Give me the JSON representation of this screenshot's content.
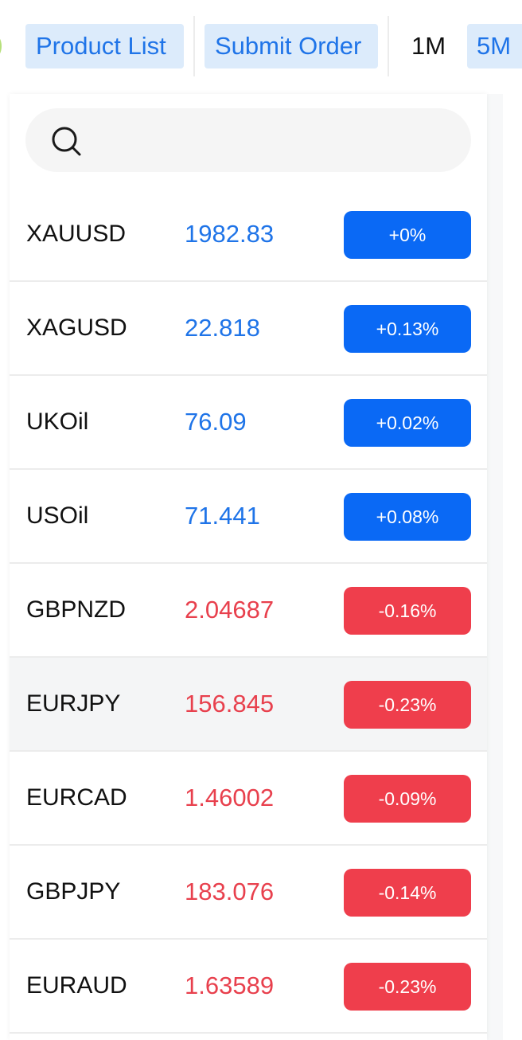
{
  "toolbar": {
    "product_list_label": "Product List",
    "submit_order_label": "Submit Order",
    "timeframes": [
      {
        "label": "1M",
        "active": false
      },
      {
        "label": "5M",
        "active": true
      }
    ]
  },
  "search": {
    "icon": "search-icon",
    "placeholder": "",
    "value": ""
  },
  "colors": {
    "accent": "#1f74e8",
    "up_badge": "#0a69f5",
    "down_badge": "#ef3e4c",
    "down_text": "#e8404d",
    "button_bg": "#dcebfb"
  },
  "quotes": [
    {
      "symbol": "XAUUSD",
      "price": "1982.83",
      "change": "+0%",
      "direction": "up",
      "selected": false
    },
    {
      "symbol": "XAGUSD",
      "price": "22.818",
      "change": "+0.13%",
      "direction": "up",
      "selected": false
    },
    {
      "symbol": "UKOil",
      "price": "76.09",
      "change": "+0.02%",
      "direction": "up",
      "selected": false
    },
    {
      "symbol": "USOil",
      "price": "71.441",
      "change": "+0.08%",
      "direction": "up",
      "selected": false
    },
    {
      "symbol": "GBPNZD",
      "price": "2.04687",
      "change": "-0.16%",
      "direction": "down",
      "selected": false
    },
    {
      "symbol": "EURJPY",
      "price": "156.845",
      "change": "-0.23%",
      "direction": "down",
      "selected": true
    },
    {
      "symbol": "EURCAD",
      "price": "1.46002",
      "change": "-0.09%",
      "direction": "down",
      "selected": false
    },
    {
      "symbol": "GBPJPY",
      "price": "183.076",
      "change": "-0.14%",
      "direction": "down",
      "selected": false
    },
    {
      "symbol": "EURAUD",
      "price": "1.63589",
      "change": "-0.23%",
      "direction": "down",
      "selected": false
    }
  ]
}
